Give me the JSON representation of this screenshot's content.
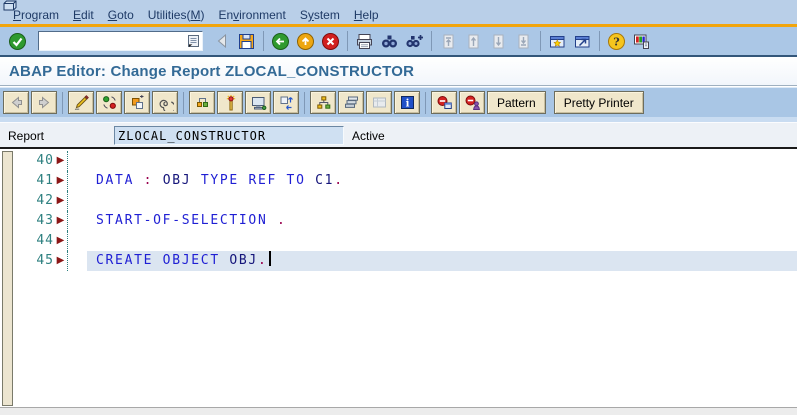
{
  "header": {
    "title": "ABAP Editor: Change Report ZLOCAL_CONSTRUCTOR"
  },
  "menu_bar": {
    "items": [
      {
        "label": "Program",
        "u": 0
      },
      {
        "label": "Edit",
        "u": 0
      },
      {
        "label": "Goto",
        "u": 0
      },
      {
        "label": "Utilities(M)",
        "u": 10
      },
      {
        "label": "Environment",
        "u": 2
      },
      {
        "label": "System",
        "u": 1
      },
      {
        "label": "Help",
        "u": 0
      }
    ]
  },
  "toolbar": {
    "command_field": {
      "value": ""
    },
    "buttons": [
      "enter-icon",
      "command-field",
      "collapse-toolbar-icon",
      "save-icon",
      "back-icon",
      "up-icon",
      "exit-icon",
      "print-icon",
      "find-icon",
      "find-next-icon",
      "first-page-icon",
      "page-up-icon",
      "page-down-icon",
      "last-page-icon",
      "new-session-icon",
      "create-shortcut-icon",
      "help-icon",
      "customize-layout-icon"
    ]
  },
  "app_toolbar": {
    "buttons": [
      "nav-back-icon",
      "nav-forward-icon",
      "display-change-icon",
      "refresh-icon",
      "copy-icon",
      "check-icon",
      "where-used-icon",
      "activate-icon",
      "test-icon",
      "navigate-icon",
      "object-list-icon",
      "stack-icon",
      "worklist-icon",
      "info-icon",
      "breakpoint-icon",
      "session-breakpoint-icon"
    ],
    "pattern_label": "Pattern",
    "pretty_printer_label": "Pretty Printer"
  },
  "report_row": {
    "label": "Report",
    "value": "ZLOCAL_CONSTRUCTOR",
    "status": "Active"
  },
  "editor": {
    "lines": [
      {
        "number": "40",
        "segments": []
      },
      {
        "number": "41",
        "segments": [
          {
            "t": "DATA ",
            "c": "kw"
          },
          {
            "t": ": ",
            "c": "pu"
          },
          {
            "t": "OBJ ",
            "c": "id"
          },
          {
            "t": "TYPE REF TO ",
            "c": "kw"
          },
          {
            "t": "C1",
            "c": "id"
          },
          {
            "t": ".",
            "c": "pu"
          }
        ]
      },
      {
        "number": "42",
        "segments": []
      },
      {
        "number": "43",
        "segments": [
          {
            "t": "START-OF-SELECTION ",
            "c": "kw"
          },
          {
            "t": ".",
            "c": "pu"
          }
        ]
      },
      {
        "number": "44",
        "segments": []
      },
      {
        "number": "45",
        "segments": [
          {
            "t": "CREATE OBJECT ",
            "c": "kw"
          },
          {
            "t": "OBJ",
            "c": "id"
          },
          {
            "t": ".",
            "c": "pu"
          }
        ],
        "current": true,
        "cursor": true
      }
    ]
  },
  "colors": {
    "accent_orange": "#F2A50C",
    "title_blue": "#336A96",
    "toolbar_blue": "#A9C6E5",
    "button_beige": "#F0E7CB",
    "keyword": "#1F1FD4",
    "identifier": "#15157A",
    "punctuation": "#99004D",
    "line_number_teal": "#2E8080",
    "line_marker_red": "#8C1717",
    "current_line_highlight": "#DBE5F1"
  }
}
